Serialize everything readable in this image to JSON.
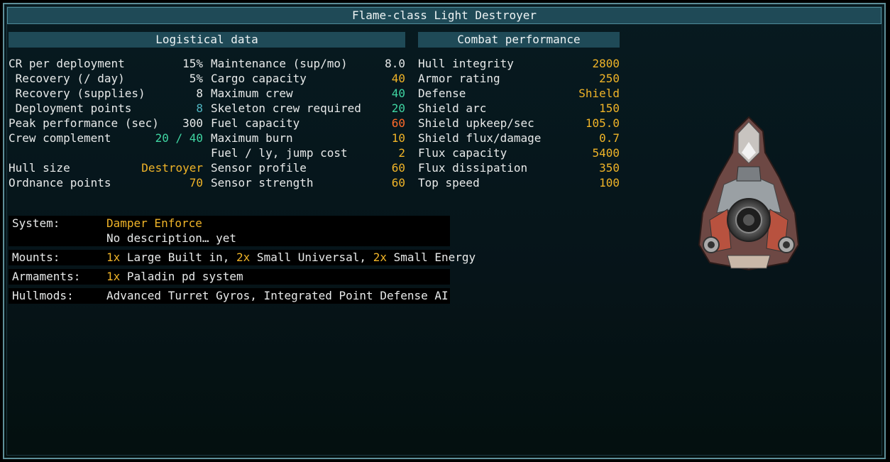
{
  "title": "Flame-class Light Destroyer",
  "logistical": {
    "header": "Logistical data",
    "left": [
      {
        "label": "CR per deployment",
        "value": "15%",
        "color": "white"
      },
      {
        "label": " Recovery (/ day)",
        "value": "5%",
        "color": "white"
      },
      {
        "label": " Recovery (supplies)",
        "value": "8",
        "color": "white"
      },
      {
        "label": " Deployment points",
        "value": "8",
        "color": "teal"
      },
      {
        "label": "Peak performance (sec)",
        "value": "300",
        "color": "white"
      },
      {
        "label": "Crew complement",
        "value": "20 / 40",
        "color": "green"
      },
      {
        "label": "",
        "value": "",
        "color": "white"
      },
      {
        "label": "Hull size",
        "value": "Destroyer",
        "color": "orange"
      },
      {
        "label": "Ordnance points",
        "value": "70",
        "color": "orange"
      }
    ],
    "right": [
      {
        "label": "Maintenance (sup/mo)",
        "value": "8.0",
        "color": "white"
      },
      {
        "label": "Cargo capacity",
        "value": "40",
        "color": "orange"
      },
      {
        "label": "Maximum crew",
        "value": "40",
        "color": "green"
      },
      {
        "label": "Skeleton crew required",
        "value": "20",
        "color": "green"
      },
      {
        "label": "Fuel capacity",
        "value": "60",
        "color": "red"
      },
      {
        "label": "Maximum burn",
        "value": "10",
        "color": "orange"
      },
      {
        "label": "Fuel / ly, jump cost",
        "value": "2",
        "color": "orange"
      },
      {
        "label": "Sensor profile",
        "value": "60",
        "color": "orange"
      },
      {
        "label": "Sensor strength",
        "value": "60",
        "color": "orange"
      }
    ]
  },
  "combat": {
    "header": "Combat performance",
    "rows": [
      {
        "label": "Hull integrity",
        "value": "2800",
        "color": "orange"
      },
      {
        "label": "Armor rating",
        "value": "250",
        "color": "orange"
      },
      {
        "label": "Defense",
        "value": "Shield",
        "color": "orange"
      },
      {
        "label": "Shield arc",
        "value": "150",
        "color": "orange"
      },
      {
        "label": "Shield upkeep/sec",
        "value": "105.0",
        "color": "orange"
      },
      {
        "label": "Shield flux/damage",
        "value": "0.7",
        "color": "orange"
      },
      {
        "label": "Flux capacity",
        "value": "5400",
        "color": "orange"
      },
      {
        "label": "Flux dissipation",
        "value": "350",
        "color": "orange"
      },
      {
        "label": "Top speed",
        "value": "100",
        "color": "orange"
      }
    ]
  },
  "details": {
    "system": {
      "label": "System:",
      "name": "Damper Enforce",
      "description": "No description… yet"
    },
    "mounts": {
      "label": "Mounts:",
      "n1": "1x",
      "t1": " Large Built in, ",
      "n2": "2x",
      "t2": " Small Universal, ",
      "n3": "2x",
      "t3": " Small Energy"
    },
    "armaments": {
      "label": "Armaments:",
      "n1": "1x",
      "t1": " Paladin pd system"
    },
    "hullmods": {
      "label": "Hullmods:",
      "value": "Advanced Turret Gyros, Integrated Point Defense AI"
    }
  },
  "colors": {
    "white": "#e8eaea",
    "orange": "#f0b428",
    "green": "#3fd5a2",
    "red": "#ff6a2a",
    "teal": "#4fb4c0",
    "header_bg": "#1f4a57",
    "border": "#5e8f99"
  },
  "ship_image": "flame-class-destroyer-sprite"
}
